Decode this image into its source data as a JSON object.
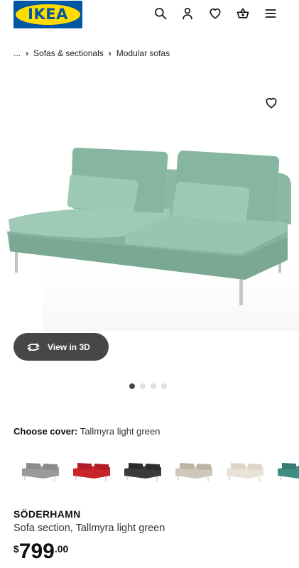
{
  "brand": {
    "logo_text": "IKEA",
    "blue": "#0058a3",
    "yellow": "#ffdb00"
  },
  "header": {
    "icons": [
      "search-icon",
      "profile-icon",
      "heart-icon",
      "basket-icon",
      "menu-icon"
    ]
  },
  "breadcrumb": {
    "items": [
      "...",
      "Sofas & sectionals",
      "Modular sofas"
    ]
  },
  "product_image": {
    "view_3d_label": "View in 3D",
    "carousel_count": 4,
    "carousel_active_index": 0
  },
  "cover": {
    "label": "Choose cover:",
    "selected": "Tallmyra light green",
    "swatches": [
      {
        "name": "grey",
        "color": "#9a9a9a"
      },
      {
        "name": "red",
        "color": "#c8242a"
      },
      {
        "name": "black",
        "color": "#3b3b3b"
      },
      {
        "name": "beige",
        "color": "#cfc8b8"
      },
      {
        "name": "white",
        "color": "#e8e2d8"
      },
      {
        "name": "green",
        "color": "#3f8c82"
      }
    ]
  },
  "product": {
    "name": "SÖDERHAMN",
    "description": "Sofa section, Tallmyra light green",
    "price_currency": "$",
    "price_int": "799",
    "price_dec": ".00"
  }
}
